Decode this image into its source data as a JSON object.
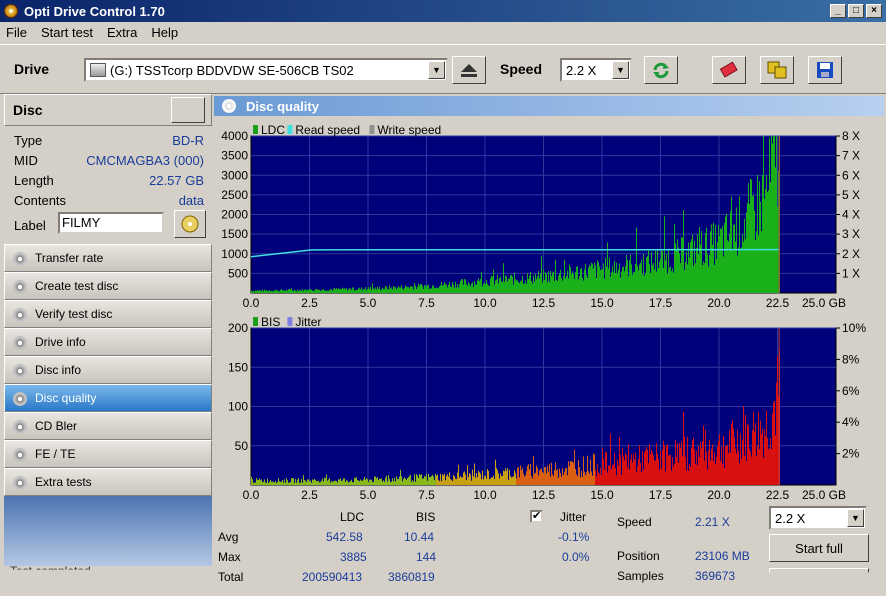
{
  "window": {
    "title": "Opti Drive Control 1.70"
  },
  "menu": [
    "File",
    "Start test",
    "Extra",
    "Help"
  ],
  "toolbar": {
    "drive_label": "Drive",
    "drive_value": "(G:)  TSSTcorp BDDVDW SE-506CB TS02",
    "speed_label": "Speed",
    "speed_value": "2.2 X"
  },
  "disc": {
    "header": "Disc",
    "fields": [
      {
        "k": "Type",
        "v": "BD-R"
      },
      {
        "k": "MID",
        "v": "CMCMAGBA3 (000)"
      },
      {
        "k": "Length",
        "v": "22.57 GB"
      },
      {
        "k": "Contents",
        "v": "data"
      }
    ],
    "label_key": "Label",
    "label_value": "FILMY"
  },
  "nav": [
    {
      "label": "Transfer rate",
      "active": false
    },
    {
      "label": "Create test disc",
      "active": false
    },
    {
      "label": "Verify test disc",
      "active": false
    },
    {
      "label": "Drive info",
      "active": false
    },
    {
      "label": "Disc info",
      "active": false
    },
    {
      "label": "Disc quality",
      "active": true
    },
    {
      "label": "CD Bler",
      "active": false
    },
    {
      "label": "FE / TE",
      "active": false
    },
    {
      "label": "Extra tests",
      "active": false
    }
  ],
  "status_text": "Test completed",
  "panel_title": "Disc quality",
  "chart_data": [
    {
      "type": "area",
      "legend": [
        {
          "name": "LDC",
          "color": "#1aa01a"
        },
        {
          "name": "Read speed",
          "color": "#40e0e0"
        },
        {
          "name": "Write speed",
          "color": "#909090"
        }
      ],
      "x_ticks": [
        "0.0",
        "2.5",
        "5.0",
        "7.5",
        "10.0",
        "12.5",
        "15.0",
        "17.5",
        "20.0",
        "22.5",
        "25.0 GB"
      ],
      "xlim": [
        0,
        25
      ],
      "y_ticks": [
        "500",
        "1000",
        "1500",
        "2000",
        "2500",
        "3000",
        "3500",
        "4000"
      ],
      "ylim": [
        0,
        4000
      ],
      "y2_ticks": [
        "1 X",
        "2 X",
        "3 X",
        "4 X",
        "5 X",
        "6 X",
        "7 X",
        "8 X"
      ],
      "y2lim": [
        0,
        8
      ],
      "ldc": {
        "x": [
          0,
          2.5,
          5,
          7.5,
          10,
          12.5,
          15,
          17.5,
          20,
          21,
          22,
          22.57
        ],
        "y": [
          60,
          80,
          110,
          180,
          300,
          420,
          620,
          820,
          1300,
          1800,
          2500,
          3700
        ]
      },
      "read_speed": {
        "x": [
          0,
          2.6,
          22.57
        ],
        "y": [
          1.85,
          2.2,
          2.21
        ]
      }
    },
    {
      "type": "area",
      "legend": [
        {
          "name": "BIS",
          "color": "#1aa01a"
        },
        {
          "name": "Jitter",
          "color": "#8080e0"
        }
      ],
      "x_ticks": [
        "0.0",
        "2.5",
        "5.0",
        "7.5",
        "10.0",
        "12.5",
        "15.0",
        "17.5",
        "20.0",
        "22.5",
        "25.0 GB"
      ],
      "xlim": [
        0,
        25
      ],
      "y_ticks": [
        "50",
        "100",
        "150",
        "200"
      ],
      "ylim": [
        0,
        200
      ],
      "y2_ticks": [
        "2%",
        "4%",
        "6%",
        "8%",
        "10%"
      ],
      "y2lim": [
        0,
        10
      ],
      "bis": {
        "x": [
          0,
          2.5,
          5,
          7.5,
          10,
          12.5,
          15,
          17.5,
          20,
          21,
          22,
          22.57
        ],
        "y": [
          6,
          6,
          7,
          10,
          14,
          20,
          28,
          38,
          50,
          60,
          75,
          120
        ]
      }
    }
  ],
  "stats": {
    "col_ldc": "LDC",
    "col_bis": "BIS",
    "rows": [
      {
        "k": "Avg",
        "ldc": "542.58",
        "bis": "10.44"
      },
      {
        "k": "Max",
        "ldc": "3885",
        "bis": "144"
      },
      {
        "k": "Total",
        "ldc": "200590413",
        "bis": "3860819"
      }
    ],
    "jitter_label": "Jitter",
    "jitter_check": "✔",
    "jitter_vals": [
      "-0.1%",
      "0.0%"
    ],
    "speed_label": "Speed",
    "speed_value": "2.21 X",
    "position_label": "Position",
    "position_value": "23106 MB",
    "samples_label": "Samples",
    "samples_value": "369673",
    "speed_select": "2.2 X",
    "start_full": "Start full",
    "start_label": "Start"
  }
}
